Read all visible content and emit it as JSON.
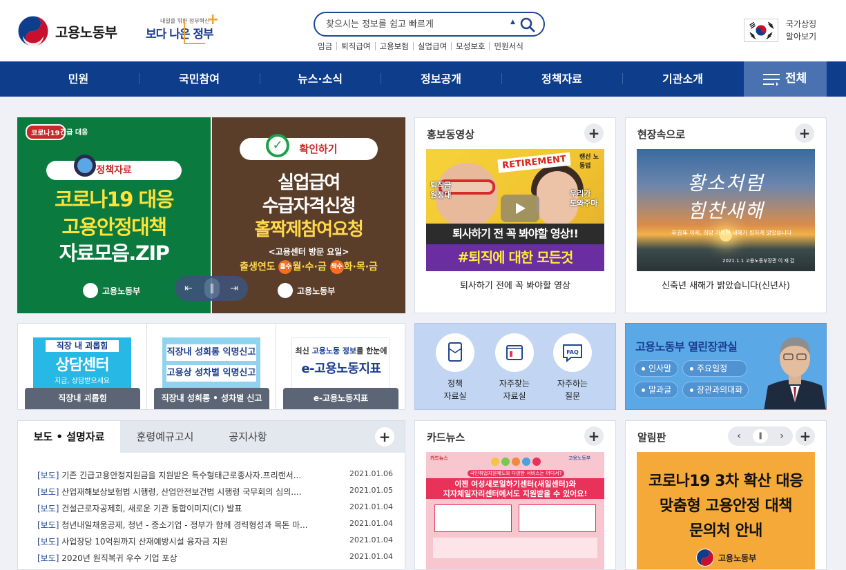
{
  "header": {
    "logo_text": "고용노동부",
    "slogan_small": "내일을 위한 정부혁신",
    "slogan_big": "보다 나은 정부",
    "search_placeholder": "찾으시는 정보를 쉽고 빠르게",
    "keywords": [
      "임금",
      "퇴직급여",
      "고용보험",
      "실업급여",
      "모성보호",
      "민원서식"
    ],
    "symbol_line1": "국가상징",
    "symbol_line2": "알아보기"
  },
  "nav": {
    "items": [
      "민원",
      "국민참여",
      "뉴스·소식",
      "정보공개",
      "정책자료",
      "기관소개"
    ],
    "all_label": "전체"
  },
  "banner": {
    "left": {
      "badge": "코로나19",
      "badge_sub": "긴급 대응",
      "pill": "정책자료",
      "line1": "코로나19 대응",
      "line2": "고용안정대책",
      "line3": "자료모음.ZIP",
      "logo": "고용노동부"
    },
    "right": {
      "pill": "확인하기",
      "line1": "실업급여",
      "line2": "수급자격신청",
      "line3": "홀짝제참여요청",
      "note": "<고용센터 방문 요일>",
      "days_prefix": "출생연도",
      "odd": "홀수",
      "days_odd": "월·수·금",
      "even": "짝수",
      "days_even": "화·목·금",
      "logo": "고용노동부"
    }
  },
  "promo_video": {
    "title": "홍보동영상",
    "retire_text": "RETIREMENT",
    "side_left": "퇴직금 원정대",
    "side_right": "우리가 도와주마",
    "tag_right": "랜선 노동법",
    "band1": "퇴사하기 전 꼭 봐야할 영상!!",
    "band2": "#퇴직에 대한 모든것",
    "caption": "퇴사하기 전에 꼭 봐야할 영상"
  },
  "field": {
    "title": "현장속으로",
    "cal1": "황소처럼",
    "cal2": "힘찬새해",
    "msg": "辛丑年 이제, 희망 가득한 새해가 힘차게 밝았습니다",
    "date": "2021.1.1 고용노동부장관 이 재 갑",
    "caption": "신축년 새해가 밝았습니다(신년사)"
  },
  "quick": [
    {
      "t1": "직장 내 괴롭힘",
      "t2": "상담센터",
      "t3": "지금, 상담받으세요",
      "label": "직장내 괴롭힘"
    },
    {
      "t1": "직장내 성희롱 익명신고",
      "t2": "고용상 성차별 익명신고",
      "label": "직장내 성희롱 • 성차별 신고"
    },
    {
      "t1_pre": "최신",
      "t1_mid": "고용노동 정보",
      "t1_post": "를 한눈에",
      "t2": "e-고용노동지표",
      "label": "e-고용노동지표"
    }
  ],
  "shortcuts": [
    {
      "line1": "정책",
      "line2": "자료실"
    },
    {
      "line1": "자주찾는",
      "line2": "자료실"
    },
    {
      "line1": "자주하는",
      "line2": "질문"
    }
  ],
  "minister": {
    "title_pre": "고용노동부",
    "title_post": "열린장관실",
    "tags": [
      "인사말",
      "주요일정",
      "말과글",
      "장관과의대화"
    ]
  },
  "news": {
    "tabs": [
      "보도 • 설명자료",
      "훈령예규고시",
      "공지사항"
    ],
    "items": [
      {
        "cat": "[보도]",
        "title": " 기존 긴급고용안정지원금을 지원받은 특수형태근로종사자.프리랜서...",
        "date": "2021.01.06"
      },
      {
        "cat": "[보도]",
        "title": " 산업재해보상보험법 시행령, 산업안전보건법 시행령 국무회의 심의....",
        "date": "2021.01.05"
      },
      {
        "cat": "[보도]",
        "title": " 건설근로자공제회, 새로운 기관 통합이미지(CI) 발표",
        "date": "2021.01.04"
      },
      {
        "cat": "[보도]",
        "title": " 청년내일채움공제, 청년 - 중소기업 - 정부가 함께 경력형성과 목돈 마...",
        "date": "2021.01.04"
      },
      {
        "cat": "[보도]",
        "title": " 사업장당 10억원까지 산재예방시설 융자금 지원",
        "date": "2021.01.04"
      },
      {
        "cat": "[보도]",
        "title": " 2020년 원직복귀 우수 기업 포상",
        "date": "2021.01.04"
      }
    ]
  },
  "cardnews": {
    "title": "카드뉴스",
    "top_left": "카드뉴스",
    "top_right": "고용노동부",
    "banner": "국민취업지원제도와 다양한 서비스는 어디서?",
    "h1": "이젠 여성새로일하기센터(새일센터)와",
    "h2": "지자체일자리센터에서도 지원받을 수 있어요!"
  },
  "notice": {
    "title": "알림판",
    "line1": "코로나19 3차 확산 대응",
    "line2": "맞춤형 고용안정 대책",
    "line3": "문의처 안내",
    "logo": "고용노동부"
  },
  "colors": {
    "nav_bg": "#0e3d8c",
    "accent": "#1f4590",
    "banner_green": "#0a7a3f",
    "banner_brown": "#5b3e2a"
  }
}
